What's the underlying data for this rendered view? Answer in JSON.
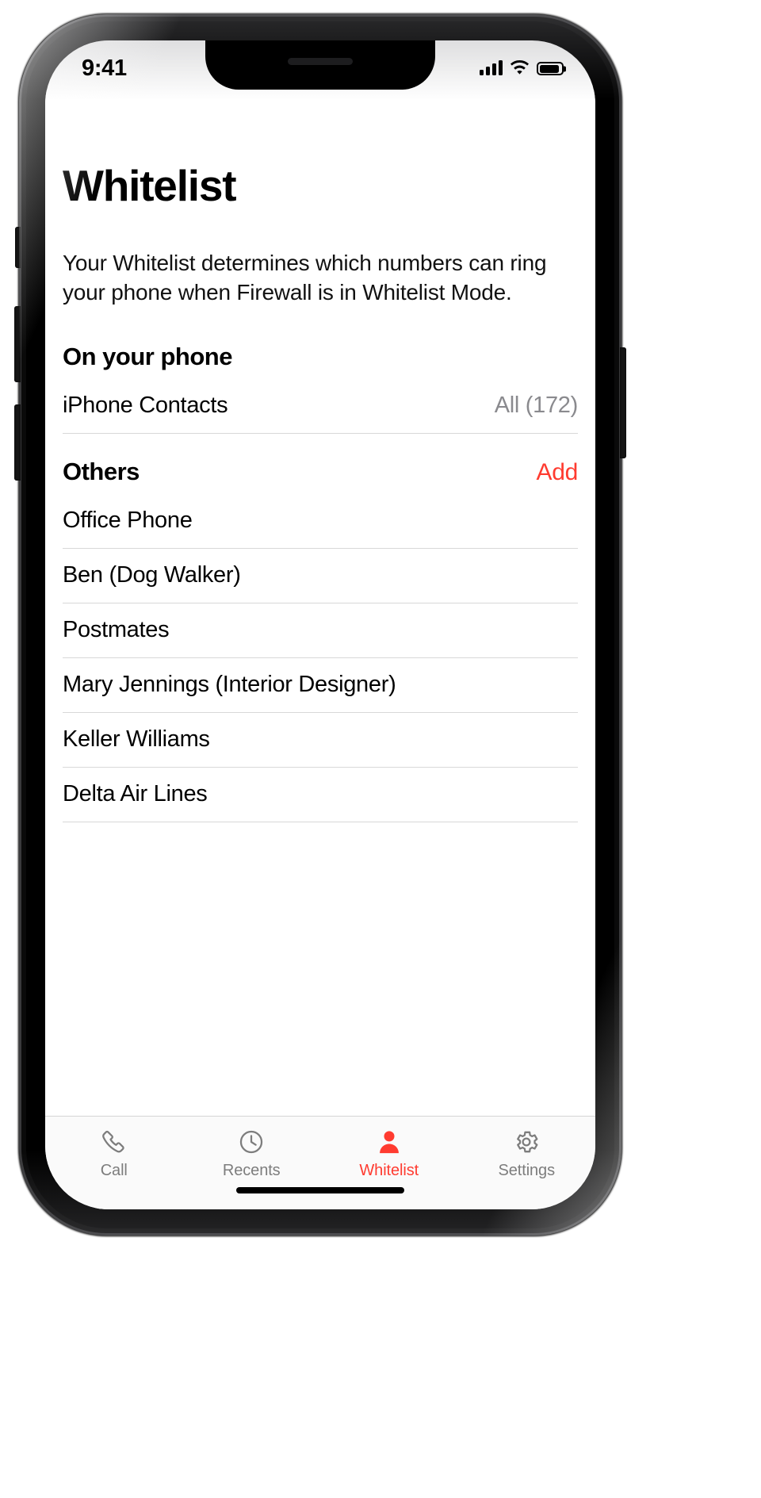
{
  "status_bar": {
    "time": "9:41",
    "signal_icon": "cellular-signal-icon",
    "wifi_icon": "wifi-icon",
    "battery_icon": "battery-icon"
  },
  "header": {
    "title": "Whitelist",
    "description": "Your Whitelist determines which numbers can ring your phone when Firewall is in Whitelist Mode."
  },
  "sections": {
    "on_your_phone": {
      "title": "On your phone",
      "rows": [
        {
          "label": "iPhone Contacts",
          "value": "All (172)"
        }
      ]
    },
    "others": {
      "title": "Others",
      "action_label": "Add",
      "rows": [
        {
          "label": "Office Phone"
        },
        {
          "label": "Ben (Dog Walker)"
        },
        {
          "label": "Postmates"
        },
        {
          "label": "Mary Jennings (Interior Designer)"
        },
        {
          "label": "Keller Williams"
        },
        {
          "label": "Delta Air Lines"
        }
      ]
    }
  },
  "tab_bar": {
    "tabs": [
      {
        "label": "Call",
        "icon": "phone-icon",
        "active": false
      },
      {
        "label": "Recents",
        "icon": "clock-icon",
        "active": false
      },
      {
        "label": "Whitelist",
        "icon": "person-icon",
        "active": true
      },
      {
        "label": "Settings",
        "icon": "gear-icon",
        "active": false
      }
    ]
  },
  "colors": {
    "accent": "#ff3b30",
    "inactive": "#7d7d7d",
    "muted_text": "#8a8a8e",
    "separator": "#d8d8d8"
  }
}
